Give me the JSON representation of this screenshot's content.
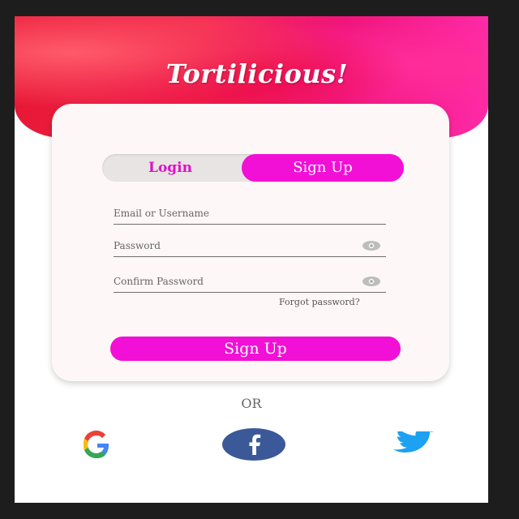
{
  "app": {
    "title": "Tortilicious!"
  },
  "auth_toggle": {
    "login_label": "Login",
    "signup_label": "Sign Up",
    "active": "signup"
  },
  "form": {
    "email_placeholder": "Email or Username",
    "password_placeholder": "Password",
    "confirm_placeholder": "Confirm Password",
    "forgot_label": "Forgot password?",
    "submit_label": "Sign Up"
  },
  "divider": {
    "label": "OR"
  },
  "social": {
    "items": [
      {
        "name": "google",
        "icon": "google-icon"
      },
      {
        "name": "facebook",
        "icon": "facebook-icon"
      },
      {
        "name": "twitter",
        "icon": "twitter-icon"
      }
    ]
  },
  "colors": {
    "accent": "#f20fd6",
    "hero_red": "#e71836",
    "hero_pink": "#ff2aa7",
    "facebook_blue": "#3b5998",
    "twitter_blue": "#1da1f2"
  }
}
